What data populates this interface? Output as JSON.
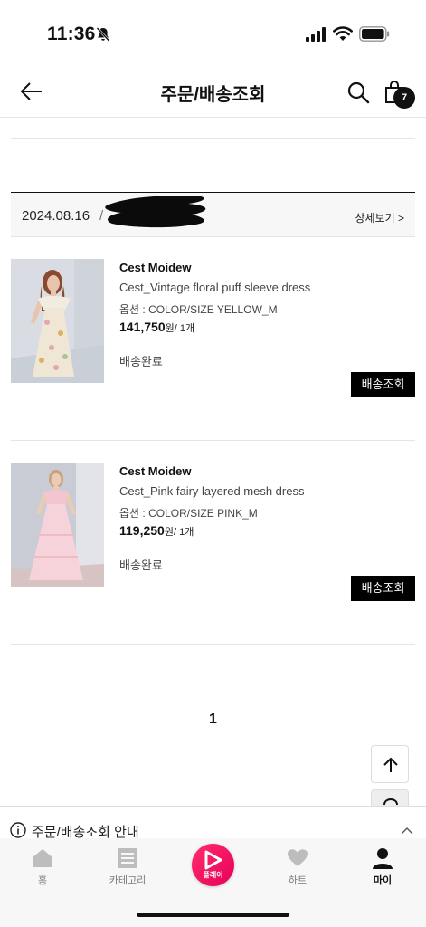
{
  "status_bar": {
    "time": "11:36"
  },
  "header": {
    "title": "주문/배송조회",
    "cart_count": "7"
  },
  "order": {
    "date": "2024.08.16",
    "separator": "/",
    "detail_label": "상세보기 >",
    "items": [
      {
        "brand": "Cest Moidew",
        "name": "Cest_Vintage floral puff sleeve dress",
        "option": "옵션 : COLOR/SIZE YELLOW_M",
        "price": "141,750",
        "price_unit": "원/ 1개",
        "status": "배송완료",
        "track_label": "배송조회"
      },
      {
        "brand": "Cest Moidew",
        "name": "Cest_Pink fairy layered mesh dress",
        "option": "옵션 : COLOR/SIZE PINK_M",
        "price": "119,250",
        "price_unit": "원/ 1개",
        "status": "배송완료",
        "track_label": "배송조회"
      }
    ]
  },
  "pagination": {
    "current": "1"
  },
  "guide": {
    "label": "주문/배송조회 안내"
  },
  "tab_bar": {
    "tabs": [
      {
        "label": "홈",
        "icon": "home-icon"
      },
      {
        "label": "카테고리",
        "icon": "category-icon"
      },
      {
        "label": "플레이",
        "icon": "play-icon"
      },
      {
        "label": "하트",
        "icon": "heart-icon"
      },
      {
        "label": "마이",
        "icon": "person-icon"
      }
    ]
  },
  "colors": {
    "accent": "#e6005c",
    "button": "#000000",
    "tab_bg": "#f7f7f7"
  }
}
